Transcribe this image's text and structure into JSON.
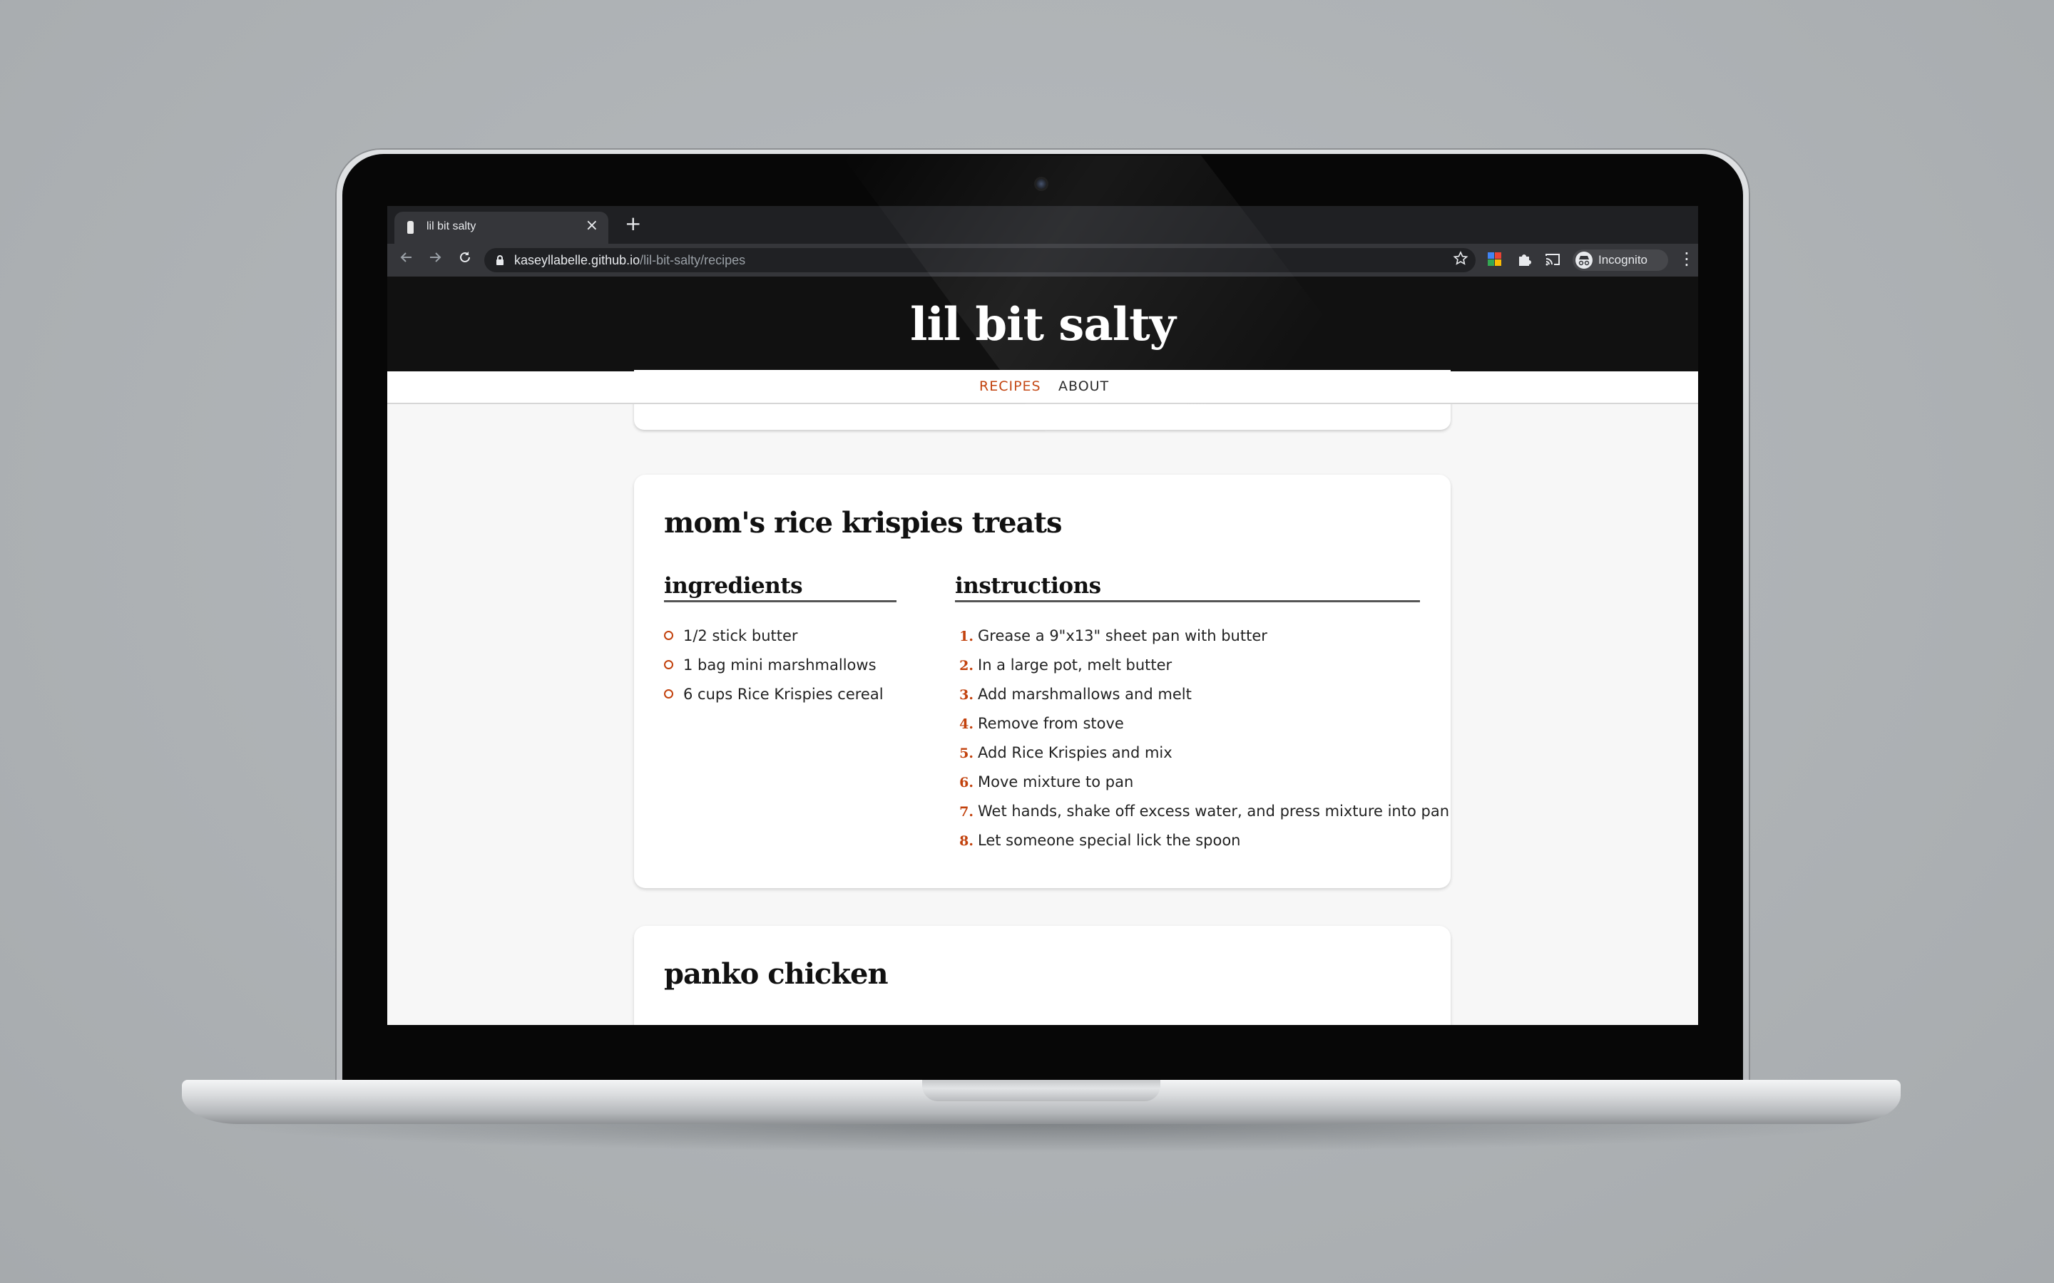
{
  "browser": {
    "tab_title": "lil bit salty",
    "tab_close": "×",
    "new_tab": "+",
    "url_host": "kaseyllabelle.github.io",
    "url_path": "/lil-bit-salty/recipes",
    "incognito_label": "Incognito",
    "icons": [
      "back-icon",
      "forward-icon",
      "reload-icon",
      "lock-icon",
      "star-icon",
      "extension-icon",
      "puzzle-icon",
      "cast-icon",
      "incognito-icon",
      "menu-icon"
    ]
  },
  "site": {
    "title": "lil bit salty",
    "nav": [
      {
        "label": "RECIPES",
        "active": true
      },
      {
        "label": "ABOUT",
        "active": false
      }
    ],
    "accent_color": "#c2410c"
  },
  "recipes": [
    {
      "title": "mom's rice krispies treats",
      "ingredients_heading": "ingredients",
      "instructions_heading": "instructions",
      "ingredients": [
        "1/2 stick butter",
        "1 bag mini marshmallows",
        "6 cups Rice Krispies cereal"
      ],
      "instructions": [
        "Grease a 9\"x13\" sheet pan with butter",
        "In a large pot, melt butter",
        "Add marshmallows and melt",
        "Remove from stove",
        "Add Rice Krispies and mix",
        "Move mixture to pan",
        "Wet hands, shake off excess water, and press mixture into pan",
        "Let someone special lick the spoon"
      ],
      "step_numbers": [
        "1.",
        "2.",
        "3.",
        "4.",
        "5.",
        "6.",
        "7.",
        "8."
      ]
    },
    {
      "title": "panko chicken"
    }
  ]
}
